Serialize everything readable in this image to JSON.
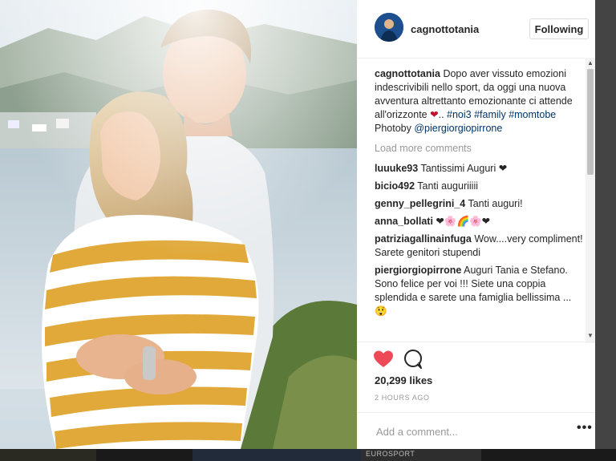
{
  "post": {
    "username": "cagnottotania",
    "follow_label": "Following",
    "caption": {
      "user": "cagnottotania",
      "text": "Dopo aver vissuto emozioni indescrivibili nello sport, da oggi una nuova avventura altrettanto emozionante ci attende all'orizzonte",
      "emoji": "❤",
      "after": "..",
      "tag1": "#noi3",
      "tag2": "#family",
      "tag3": "#momtobe",
      "photo_prefix": "Photoby",
      "photo_mention": "@piergiorgiopirrone"
    },
    "load_more": "Load more comments",
    "comments": [
      {
        "user": "luuuke93",
        "text": "Tantissimi Auguri ❤"
      },
      {
        "user": "bicio492",
        "text": "Tanti auguriiiii"
      },
      {
        "user": "genny_pellegrini_4",
        "text": "Tanti auguri!"
      },
      {
        "user": "anna_bollati",
        "text": "❤🌸🌈🌸❤"
      },
      {
        "user": "patriziagallinainfuga",
        "text": "Wow....very compliment! Sarete genitori stupendi"
      },
      {
        "user": "piergiorgiopirrone",
        "text": "Auguri Tania e Stefano. Sono felice per voi !!! Siete una coppia splendida e sarete una famiglia bellissima ... 😲"
      }
    ],
    "likes": "20,299 likes",
    "time": "2 HOURS AGO",
    "add_comment_placeholder": "Add a comment...",
    "more_label": "•••"
  },
  "background": {
    "tile_label": "EUROSPORT"
  },
  "colors": {
    "heart": "#ed4956",
    "link": "#003569",
    "text": "#262626",
    "muted": "#999999"
  },
  "icons": [
    "heart-icon",
    "comment-icon",
    "more-options-icon"
  ]
}
